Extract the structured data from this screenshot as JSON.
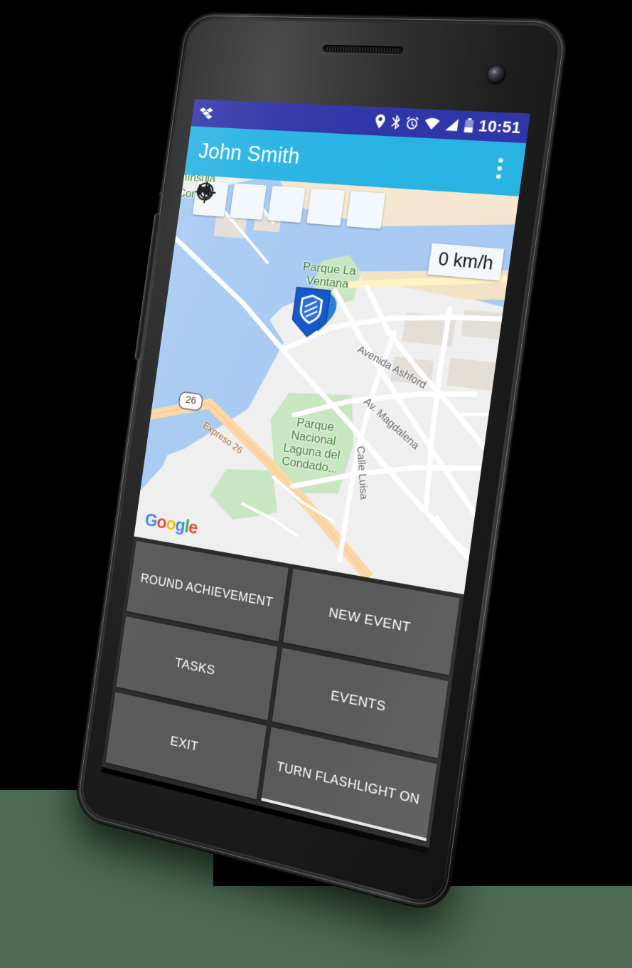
{
  "status_bar": {
    "notification_icon": "dropbox-icon",
    "icons": [
      "location-pin-icon",
      "bluetooth-icon",
      "alarm-clock-icon",
      "wifi-icon",
      "signal-icon",
      "battery-icon"
    ],
    "clock": "10:51"
  },
  "toolbar": {
    "title": "John Smith",
    "overflow_label": "overflow-menu"
  },
  "map": {
    "controls": [
      {
        "name": "skip-previous-button",
        "icon": "skip-previous-icon"
      },
      {
        "name": "skip-next-button",
        "icon": "skip-next-icon"
      },
      {
        "name": "my-location-button",
        "icon": "crosshair-target-icon"
      },
      {
        "name": "zoom-in-button",
        "icon": "plus-circle-icon"
      },
      {
        "name": "zoom-out-button",
        "icon": "minus-circle-icon"
      }
    ],
    "speed": "0 km/h",
    "marker_icon": "shield-map-marker",
    "attribution": "Google",
    "labels": [
      {
        "text": "nínsula",
        "type": "place"
      },
      {
        "text": "Condado",
        "type": "place"
      },
      {
        "text": "Parque La\nVentana",
        "type": "park"
      },
      {
        "text": "Parque\nNacional\nLaguna del\nCondado...",
        "type": "park"
      },
      {
        "text": "Avenida Ashford",
        "type": "road"
      },
      {
        "text": "Av. Magdalena",
        "type": "road"
      },
      {
        "text": "Calle Luisa",
        "type": "road"
      },
      {
        "text": "Expreso 26",
        "type": "highway"
      },
      {
        "text": "26",
        "type": "shield"
      }
    ],
    "colors": {
      "water": "#a8caf2",
      "land": "#efefef",
      "park": "#c9e6c3",
      "highway": "#fbd7a7",
      "road": "#ffffff",
      "building": "#e3ded6"
    }
  },
  "actions": {
    "buttons": [
      {
        "label": "ROUND ACHIEVEMENT",
        "name": "round-achievement-button"
      },
      {
        "label": "NEW EVENT",
        "name": "new-event-button"
      },
      {
        "label": "TASKS",
        "name": "tasks-button"
      },
      {
        "label": "EVENTS",
        "name": "events-button"
      },
      {
        "label": "EXIT",
        "name": "exit-button"
      },
      {
        "label": "TURN FLASHLIGHT ON",
        "name": "turn-flashlight-on-button"
      }
    ]
  },
  "theme": {
    "status_bar_bg": "#3036a8",
    "toolbar_bg": "#29b3e3",
    "grid_bg": "#2b2b2b",
    "button_bg": "#5a5a5a",
    "page_bg": "#4a6a51"
  }
}
